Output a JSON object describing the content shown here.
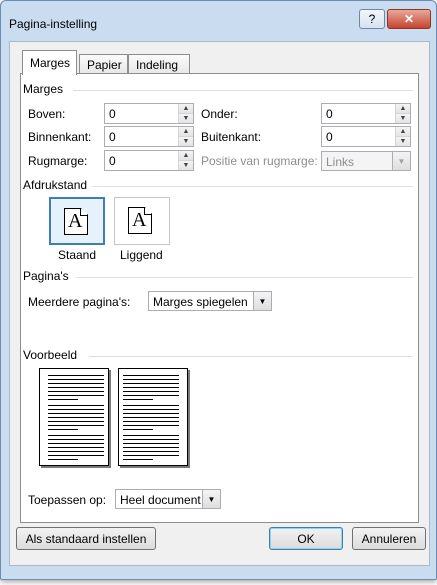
{
  "window": {
    "title": "Pagina-instelling",
    "help_glyph": "?",
    "close_glyph": "✕"
  },
  "tabs": [
    {
      "label": "Marges",
      "active": true
    },
    {
      "label": "Papier",
      "active": false
    },
    {
      "label": "Indeling",
      "active": false
    }
  ],
  "margins": {
    "heading": "Marges",
    "top": {
      "label": "Boven:",
      "value": "0"
    },
    "inside": {
      "label": "Binnenkant:",
      "value": "0"
    },
    "gutter": {
      "label": "Rugmarge:",
      "value": "0"
    },
    "bottom": {
      "label": "Onder:",
      "value": "0"
    },
    "outside": {
      "label": "Buitenkant:",
      "value": "0"
    },
    "gutter_pos": {
      "label": "Positie van rugmarge:",
      "value": "Links"
    }
  },
  "orientation": {
    "heading": "Afdrukstand",
    "portrait": {
      "label": "Staand",
      "glyph": "A"
    },
    "landscape": {
      "label": "Liggend",
      "glyph": "A"
    }
  },
  "pages": {
    "heading": "Pagina's",
    "multiple": {
      "label": "Meerdere pagina's:",
      "value": "Marges spiegelen"
    }
  },
  "preview": {
    "heading": "Voorbeeld"
  },
  "apply": {
    "label": "Toepassen op:",
    "value": "Heel document"
  },
  "buttons": {
    "default": "Als standaard instellen",
    "ok": "OK",
    "cancel": "Annuleren"
  },
  "icons": {
    "spin_up": "▲",
    "spin_down": "▼",
    "dropdown": "▼"
  }
}
